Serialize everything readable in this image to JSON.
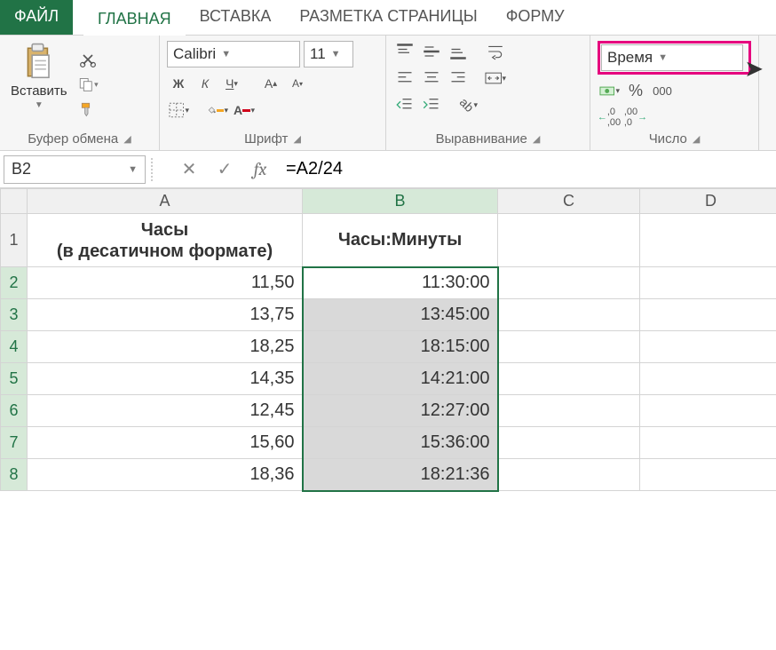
{
  "tabs": {
    "file": "ФАЙЛ",
    "home": "ГЛАВНАЯ",
    "insert": "ВСТАВКА",
    "page_layout": "РАЗМЕТКА СТРАНИЦЫ",
    "formulas": "ФОРМУ"
  },
  "ribbon": {
    "clipboard": {
      "paste": "Вставить",
      "label": "Буфер обмена"
    },
    "font": {
      "name": "Calibri",
      "size": "11",
      "bold": "Ж",
      "italic": "К",
      "underline": "Ч",
      "label": "Шрифт"
    },
    "alignment": {
      "label": "Выравнивание"
    },
    "number": {
      "format": "Время",
      "percent": "%",
      "thousand": "000",
      "inc_dec": ",0",
      "dec_inc": ",00",
      "dec_arrow_l": "←,0",
      "dec_arrow_r": ",00→",
      "label": "Число"
    }
  },
  "namebox": "B2",
  "formula": "=A2/24",
  "columns": [
    "A",
    "B",
    "C",
    "D"
  ],
  "header_row": {
    "A": "Часы\n(в десатичном формате)",
    "B": "Часы:Минуты"
  },
  "rows": [
    {
      "n": "1"
    },
    {
      "n": "2",
      "A": "11,50",
      "B": "11:30:00"
    },
    {
      "n": "3",
      "A": "13,75",
      "B": "13:45:00"
    },
    {
      "n": "4",
      "A": "18,25",
      "B": "18:15:00"
    },
    {
      "n": "5",
      "A": "14,35",
      "B": "14:21:00"
    },
    {
      "n": "6",
      "A": "12,45",
      "B": "12:27:00"
    },
    {
      "n": "7",
      "A": "15,60",
      "B": "15:36:00"
    },
    {
      "n": "8",
      "A": "18,36",
      "B": "18:21:36"
    }
  ]
}
